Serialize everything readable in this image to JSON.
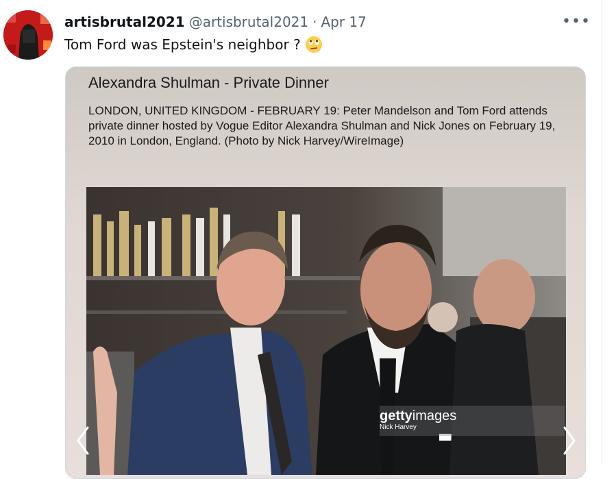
{
  "tweet": {
    "display_name": "artisbrutal2021",
    "handle": "@artisbrutal2021",
    "separator": "·",
    "date": "Apr 17",
    "text": "Tom Ford was Epstein's neighbor ?",
    "emoji_icon": "face-with-rolling-eyes-emoji",
    "more_icon": "more-horizontal-icon",
    "more_glyph": "•••"
  },
  "embed": {
    "title": "Alexandra Shulman - Private Dinner",
    "caption": "LONDON, UNITED KINGDOM - FEBRUARY 19: Peter Mandelson and Tom Ford attends private dinner hosted by Vogue Editor Alexandra Shulman and Nick Jones on February 19, 2010 in London, England. (Photo by Nick Harvey/WireImage)",
    "watermark_brand_bold": "getty",
    "watermark_brand_rest": "images",
    "watermark_credit": "Nick Harvey",
    "nav_prev_icon": "chevron-left-icon",
    "nav_next_icon": "chevron-right-icon"
  },
  "colors": {
    "text_primary": "#0f1419",
    "text_secondary": "#536471",
    "avatar_red": "#c41a1a",
    "card_border": "#cfd9de"
  }
}
